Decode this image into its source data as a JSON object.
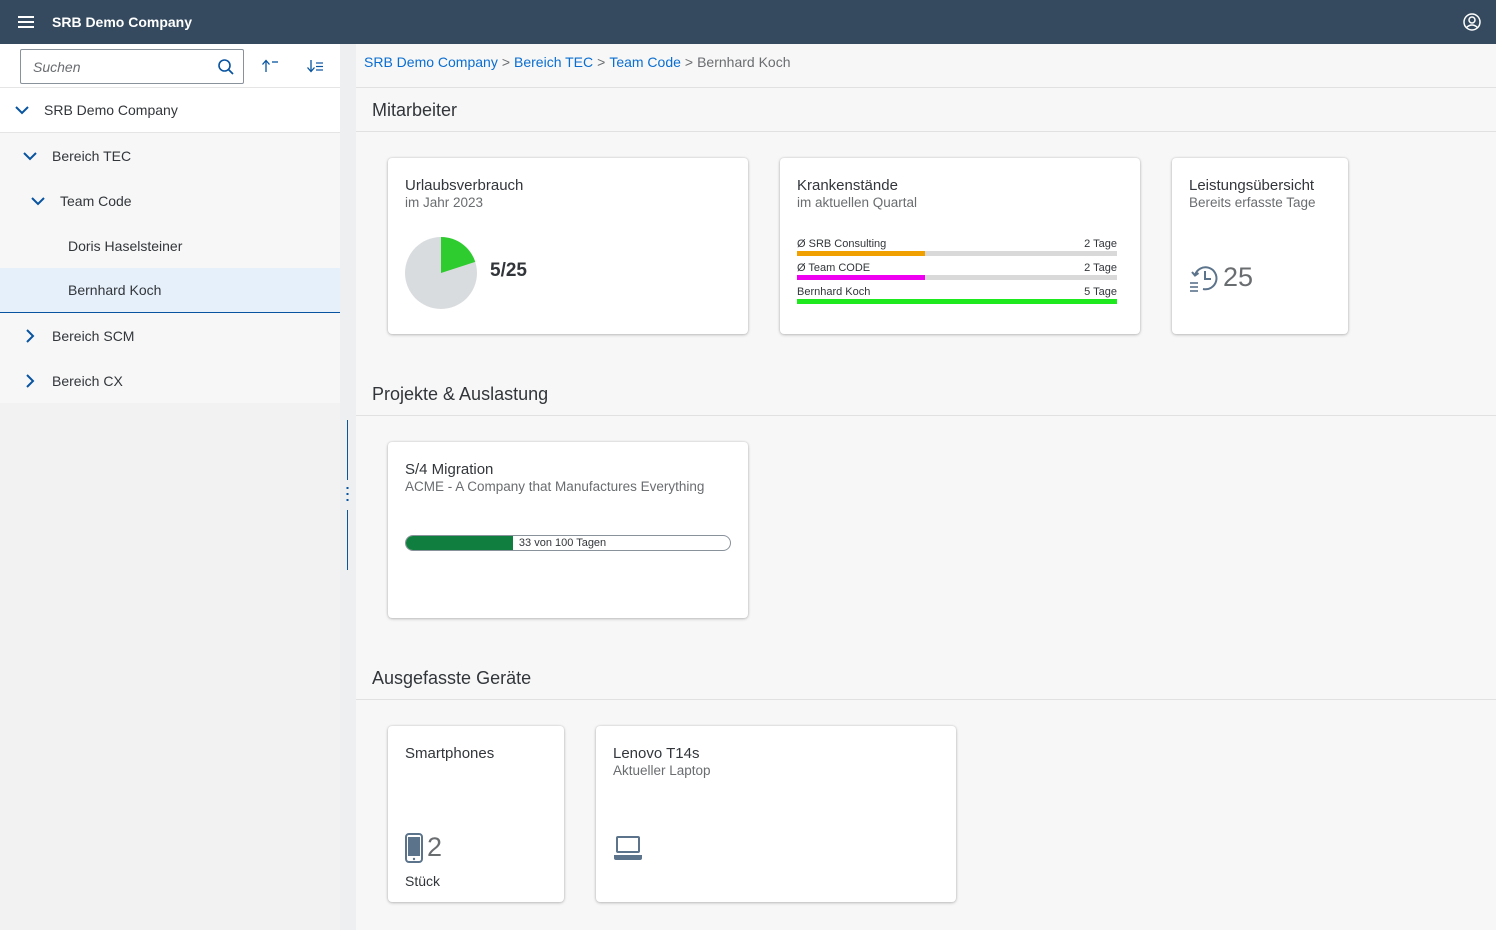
{
  "shell": {
    "title": "SRB Demo Company"
  },
  "sidebar": {
    "search_placeholder": "Suchen",
    "tree": [
      {
        "label": "SRB Demo Company",
        "expanded": true
      },
      {
        "label": "Bereich TEC",
        "expanded": true
      },
      {
        "label": "Team Code",
        "expanded": true
      },
      {
        "label": "Doris Haselsteiner"
      },
      {
        "label": "Bernhard Koch",
        "selected": true
      },
      {
        "label": "Bereich SCM",
        "expanded": false
      },
      {
        "label": "Bereich CX",
        "expanded": false
      }
    ]
  },
  "breadcrumb": {
    "links": [
      "SRB Demo Company",
      "Bereich TEC",
      "Team Code"
    ],
    "current": "Bernhard Koch",
    "separator": ">"
  },
  "sections": {
    "mitarbeiter": "Mitarbeiter",
    "projekte": "Projekte & Auslastung",
    "geraete": "Ausgefasste Geräte"
  },
  "cards": {
    "urlaub": {
      "title": "Urlaubsverbrauch",
      "subtitle": "im Jahr 2023",
      "value_text": "5/25",
      "used": 5,
      "total": 25,
      "color": "#2ecc2e"
    },
    "krank": {
      "title": "Krankenstände",
      "subtitle": "im aktuellen Quartal",
      "rows": [
        {
          "label": "Ø SRB Consulting",
          "value_text": "2 Tage",
          "fraction": 0.4,
          "color": "#f0a000"
        },
        {
          "label": "Ø Team CODE",
          "value_text": "2 Tage",
          "fraction": 0.4,
          "color": "#f000f0"
        },
        {
          "label": "Bernhard Koch",
          "value_text": "5 Tage",
          "fraction": 1.0,
          "color": "#1ee81e"
        }
      ]
    },
    "leistung": {
      "title": "Leistungsübersicht",
      "subtitle": "Bereits erfasste Tage",
      "value": "25"
    },
    "projekt": {
      "title": "S/4 Migration",
      "subtitle": "ACME - A Company that Manufactures Everything",
      "progress_text": "33 von 100 Tagen",
      "progress": 0.33
    },
    "smartphones": {
      "title": "Smartphones",
      "value": "2",
      "unit": "Stück"
    },
    "laptop": {
      "title": "Lenovo T14s",
      "subtitle": "Aktueller Laptop"
    }
  },
  "icons": [
    "menu-icon",
    "user-icon",
    "search-icon",
    "sort-ascending-icon",
    "sort-descending-icon",
    "chevron-down-icon",
    "chevron-right-icon",
    "history-icon",
    "iphone-icon",
    "laptop-icon"
  ],
  "colors": {
    "shell": "#354a5f",
    "link": "#0a6ed1",
    "progress": "#107e3e",
    "selected": "#e5f0fa"
  }
}
